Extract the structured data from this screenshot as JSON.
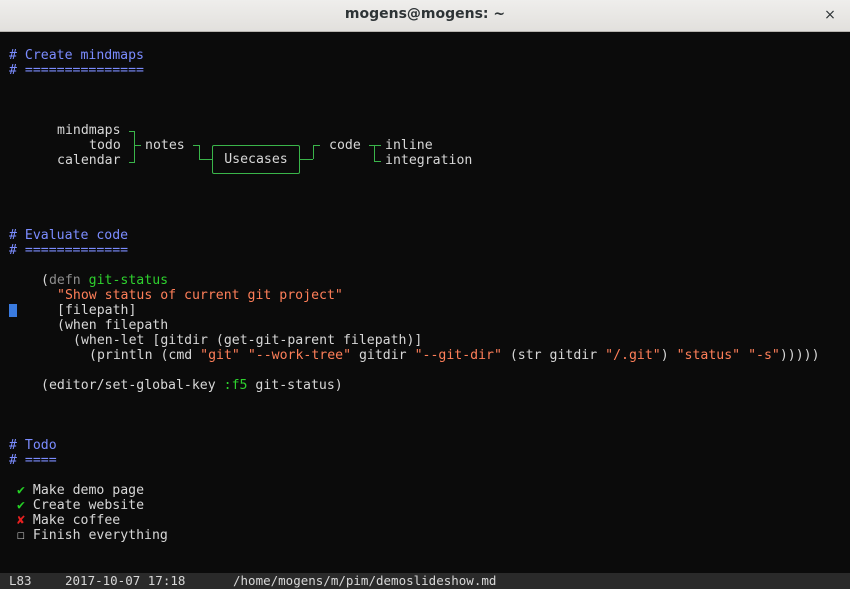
{
  "window": {
    "title": "mogens@mogens: ~",
    "close_symbol": "×"
  },
  "doc": {
    "h1": "# Create mindmaps",
    "h1_rule": "# ===============",
    "mindmap": {
      "left_items": [
        "mindmaps",
        "todo",
        "calendar"
      ],
      "left_parent": "notes",
      "center": "Usecases",
      "right_parent": "code",
      "right_items": [
        "inline",
        "integration"
      ]
    },
    "h2": "# Evaluate code",
    "h2_rule": "# =============",
    "code": {
      "l1_open": "(",
      "l1_kw": "defn",
      "l1_space": " ",
      "l1_name": "git-status",
      "l2_str": "\"Show status of current git project\"",
      "l3": "[filepath]",
      "l4": "(when filepath",
      "l5": "(when-let [gitdir (get-git-parent filepath)]",
      "l6_a": "(println (cmd ",
      "l6_s1": "\"git\"",
      "l6_sp1": " ",
      "l6_s2": "\"--work-tree\"",
      "l6_b": " gitdir ",
      "l6_s3": "\"--git-dir\"",
      "l6_c": " (str gitdir ",
      "l6_s4": "\"/.git\"",
      "l6_d": ") ",
      "l6_s5": "\"status\"",
      "l6_sp2": " ",
      "l6_s6": "\"-s\"",
      "l6_e": ")))))",
      "l7_a": "(editor/set-global-key ",
      "l7_key": ":f5",
      "l7_b": " git-status)"
    },
    "h3": "# Todo",
    "h3_rule": "# ====",
    "todos": [
      {
        "mark": "✔",
        "text": " Make demo page"
      },
      {
        "mark": "✔",
        "text": " Create website"
      },
      {
        "mark": "✘",
        "text": " Make coffee"
      },
      {
        "mark": "☐",
        "text": " Finish everything"
      }
    ]
  },
  "status": {
    "line": "L83",
    "datetime": "2017-10-07 17:18",
    "path": "/home/mogens/m/pim/demoslideshow.md"
  },
  "colors": {
    "heading": "#7b8cff",
    "function_name": "#2ed12e",
    "string": "#ff7f59",
    "mindmap_connector": "#3ab54a",
    "cursor": "#3a7be0",
    "check": "#25d025",
    "cross": "#e62020"
  }
}
